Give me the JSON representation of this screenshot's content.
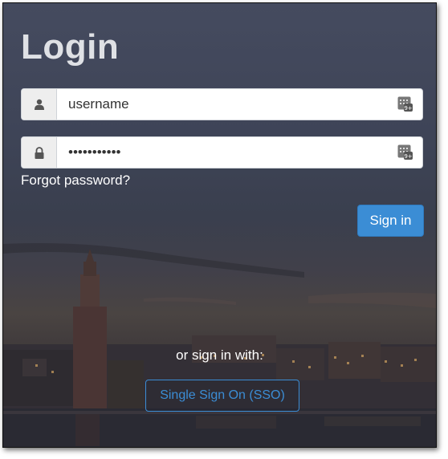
{
  "login": {
    "title": "Login",
    "username": {
      "value": "username",
      "icon": "user-icon"
    },
    "password": {
      "value": "•••••••••••",
      "icon": "lock-icon"
    },
    "keypad_icon": "keypad-icon",
    "forgot_password": "Forgot password?",
    "sign_in_label": "Sign in",
    "or_sign_in_with": "or sign in with:",
    "sso_label": "Single Sign On (SSO)"
  },
  "colors": {
    "primary": "#3b8dd5",
    "title": "#dfe1e5",
    "background_top": "#454b5f",
    "background_bottom": "#2c2a31"
  }
}
